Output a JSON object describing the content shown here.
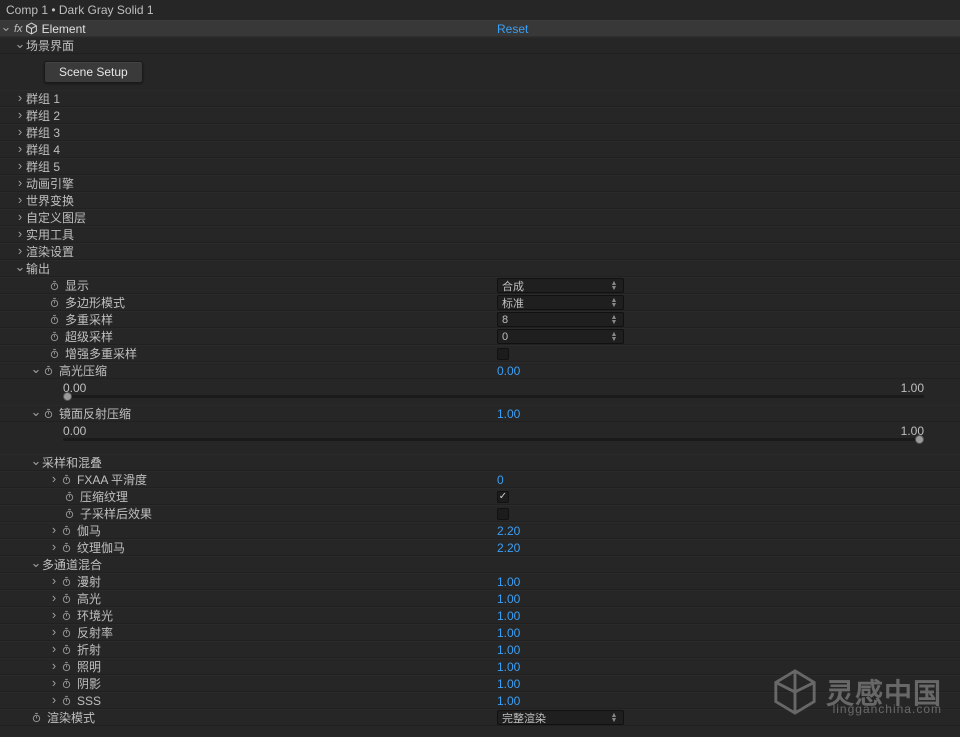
{
  "header": {
    "title": "Comp 1 • Dark Gray Solid 1"
  },
  "effect": {
    "name": "Element",
    "reset": "Reset"
  },
  "scene": {
    "section": "场景界面",
    "setup_btn": "Scene Setup"
  },
  "groups": {
    "g1": "群组 1",
    "g2": "群组 2",
    "g3": "群组 3",
    "g4": "群组 4",
    "g5": "群组 5",
    "anim": "动画引擎",
    "world": "世界变换",
    "custom": "自定义图层",
    "util": "实用工具",
    "render_set": "渲染设置"
  },
  "output": {
    "section": "输出",
    "display": {
      "label": "显示",
      "value": "合成"
    },
    "polymode": {
      "label": "多边形模式",
      "value": "标准"
    },
    "multisample": {
      "label": "多重采样",
      "value": "8"
    },
    "supersample": {
      "label": "超级采样",
      "value": "0"
    },
    "enhance_ms": {
      "label": "增强多重采样"
    },
    "highlight_comp": {
      "label": "高光压缩",
      "value": "0.00",
      "min": "0.00",
      "max": "1.00"
    },
    "specular_comp": {
      "label": "镜面反射压缩",
      "value": "1.00",
      "min": "0.00",
      "max": "1.00"
    }
  },
  "sampling": {
    "section": "采样和混叠",
    "fxaa": {
      "label": "FXAA  平滑度",
      "value": "0"
    },
    "comp_tex": {
      "label": "压缩纹理"
    },
    "subsample": {
      "label": "子采样后效果"
    },
    "gamma": {
      "label": "伽马",
      "value": "2.20"
    },
    "tex_gamma": {
      "label": "纹理伽马",
      "value": "2.20"
    }
  },
  "multipass": {
    "section": "多通道混合",
    "diffuse": {
      "label": "漫射",
      "value": "1.00"
    },
    "specular": {
      "label": "高光",
      "value": "1.00"
    },
    "ambient": {
      "label": "环境光",
      "value": "1.00"
    },
    "reflect": {
      "label": "反射率",
      "value": "1.00"
    },
    "refract": {
      "label": "折射",
      "value": "1.00"
    },
    "illum": {
      "label": "照明",
      "value": "1.00"
    },
    "shadow": {
      "label": "阴影",
      "value": "1.00"
    },
    "sss": {
      "label": "SSS",
      "value": "1.00"
    }
  },
  "render_mode": {
    "label": "渲染模式",
    "value": "完整渲染"
  },
  "watermark": {
    "text": "灵感中国",
    "sub": "lingganchina.com"
  }
}
